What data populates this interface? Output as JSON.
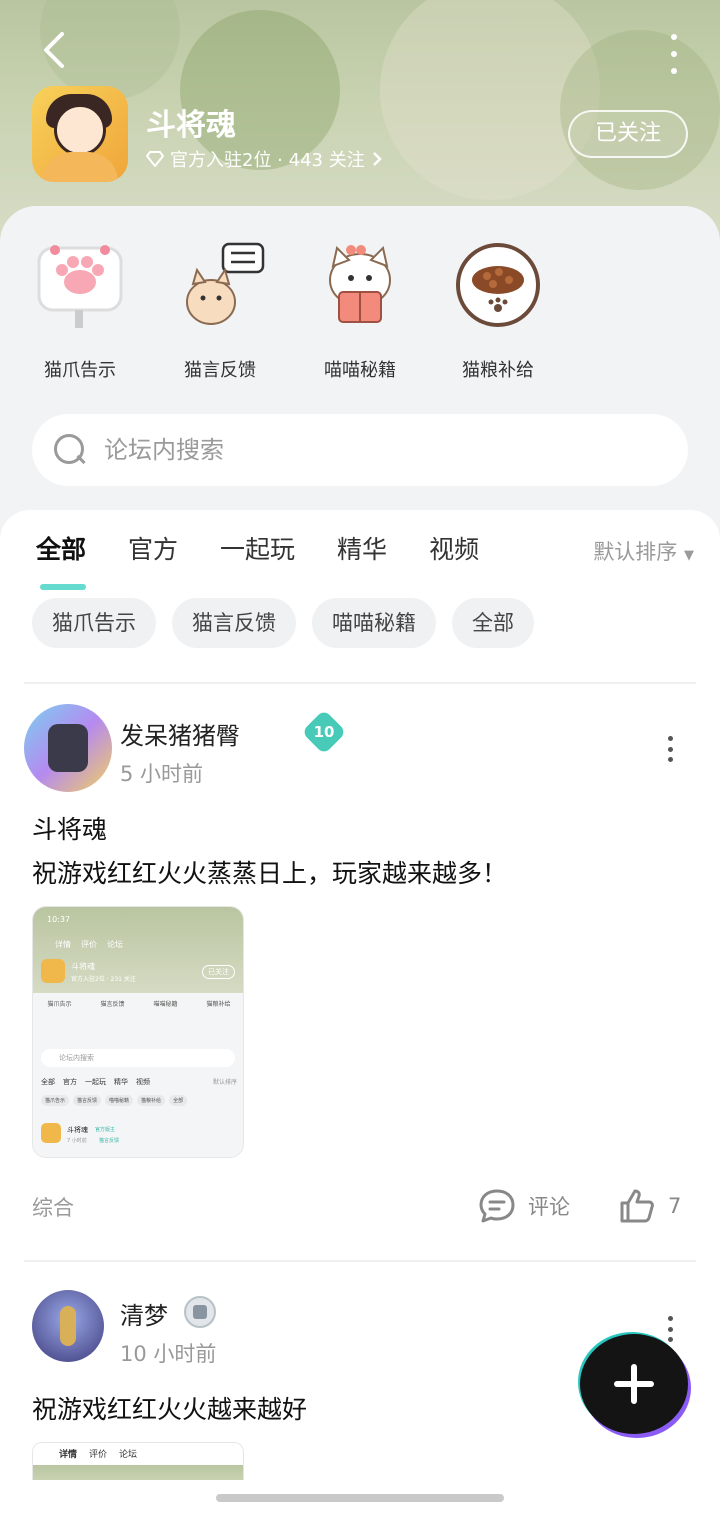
{
  "header": {
    "app_name": "斗将魂",
    "meta": "官方入驻2位 · 443 关注",
    "follow_label": "已关注"
  },
  "entries": [
    {
      "label": "猫爪告示",
      "icon": "paw-sign-icon"
    },
    {
      "label": "猫言反馈",
      "icon": "cat-feedback-icon"
    },
    {
      "label": "喵喵秘籍",
      "icon": "cat-book-icon"
    },
    {
      "label": "猫粮补给",
      "icon": "cat-food-bowl-icon"
    }
  ],
  "search": {
    "placeholder": "论坛内搜索"
  },
  "tabs": [
    "全部",
    "官方",
    "一起玩",
    "精华",
    "视频"
  ],
  "sort_label": "默认排序",
  "chips": [
    "猫爪告示",
    "猫言反馈",
    "喵喵秘籍",
    "全部"
  ],
  "posts": [
    {
      "author": "发呆猪猪臀",
      "level": "10",
      "time": "5 小时前",
      "title": "斗将魂",
      "body": "祝游戏红红火火蒸蒸日上，玩家越来越多！",
      "category": "综合",
      "comment_label": "评论",
      "likes": "7"
    },
    {
      "author": "清梦",
      "time": "10 小时前",
      "body": "祝游戏红红火火越来越好"
    }
  ],
  "thumb1": {
    "time": "10:37",
    "tabs": [
      "详情",
      "评价",
      "论坛"
    ],
    "app_name": "斗将魂",
    "meta": "官方入驻2位 · 231 关注",
    "follow": "已关注",
    "entries": [
      "猫爪告示",
      "猫言反馈",
      "喵喵秘籍",
      "猫粮补给"
    ],
    "search": "论坛内搜索",
    "tabs2": [
      "全部",
      "官方",
      "一起玩",
      "精华",
      "视频"
    ],
    "sort": "默认排序",
    "chips": [
      "猫爪告示",
      "猫言反馈",
      "喵喵秘籍",
      "猫粮补给",
      "全部"
    ],
    "post_name": "斗将魂",
    "post_badge": "官方版主",
    "post_time": "7 小时前",
    "post_tag": "猫言反馈"
  },
  "thumb2": {
    "tabs": [
      "详情",
      "评价",
      "论坛"
    ]
  },
  "colors": {
    "accent": "#3fd1c3",
    "level_badge": "#47cbb8",
    "fab": "#141414"
  }
}
